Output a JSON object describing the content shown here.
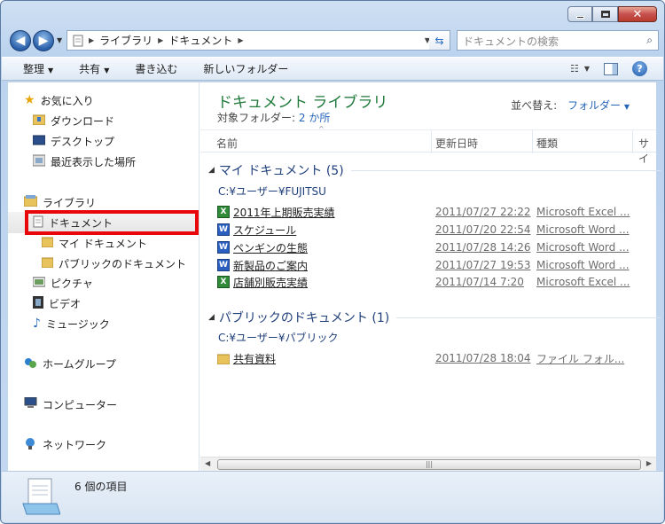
{
  "nav": {
    "breadcrumbs": [
      "ライブラリ",
      "ドキュメント"
    ],
    "search_placeholder": "ドキュメントの検索"
  },
  "toolbar": {
    "organize": "整理",
    "share": "共有",
    "burn": "書き込む",
    "new_folder": "新しいフォルダー"
  },
  "sidebar": {
    "favorites": "お気に入り",
    "downloads": "ダウンロード",
    "desktop": "デスクトップ",
    "recent": "最近表示した場所",
    "libraries": "ライブラリ",
    "documents": "ドキュメント",
    "my_documents": "マイ ドキュメント",
    "public_documents": "パブリックのドキュメント",
    "pictures": "ピクチャ",
    "videos": "ビデオ",
    "music": "ミュージック",
    "homegroup": "ホームグループ",
    "computer": "コンピューター",
    "network": "ネットワーク"
  },
  "main": {
    "title": "ドキュメント ライブラリ",
    "subtitle_prefix": "対象フォルダー:",
    "subtitle_link": "2 か所",
    "sort_label": "並べ替え:",
    "sort_value": "フォルダー",
    "columns": [
      "名前",
      "更新日時",
      "種類",
      "サイ"
    ],
    "groups": [
      {
        "title": "マイ ドキュメント (5)",
        "path": "C:¥ユーザー¥FUJITSU",
        "items": [
          {
            "name": "2011年上期販売実績",
            "date": "2011/07/27 22:22",
            "type": "Microsoft Excel ...",
            "icon": "excel-icon"
          },
          {
            "name": "スケジュール",
            "date": "2011/07/20 22:54",
            "type": "Microsoft Word ...",
            "icon": "word-icon"
          },
          {
            "name": "ペンギンの生態",
            "date": "2011/07/28 14:26",
            "type": "Microsoft Word ...",
            "icon": "word-icon"
          },
          {
            "name": "新製品のご案内",
            "date": "2011/07/27 19:53",
            "type": "Microsoft Word ...",
            "icon": "word-icon"
          },
          {
            "name": "店舗別販売実績",
            "date": "2011/07/14 7:20",
            "type": "Microsoft Excel ...",
            "icon": "excel-icon"
          }
        ]
      },
      {
        "title": "パブリックのドキュメント (1)",
        "path": "C:¥ユーザー¥パブリック",
        "items": [
          {
            "name": "共有資料",
            "date": "2011/07/28 18:04",
            "type": "ファイル フォル...",
            "icon": "folder-icon"
          }
        ]
      }
    ]
  },
  "status": {
    "count": "6 個の項目"
  }
}
